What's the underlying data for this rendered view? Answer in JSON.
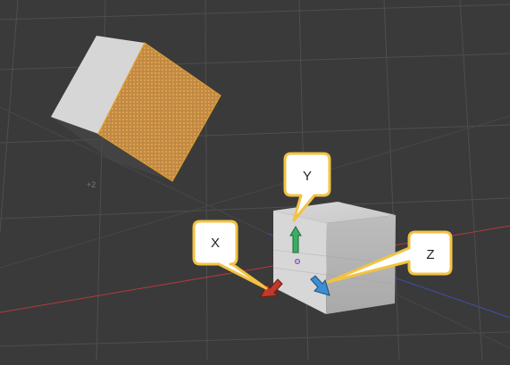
{
  "viewport": {
    "name": "3d-viewport",
    "background": "#3a3a3a",
    "grid_color": "#4f4f4f",
    "x_axis_color": "#b33a3a",
    "z_axis_color": "#3d4fb3",
    "selection_color": "#e0a030"
  },
  "grid_label": "+2",
  "callouts": {
    "x": {
      "label": "X",
      "arrow_color": "#c0392b"
    },
    "y": {
      "label": "Y",
      "arrow_color": "#3cae63"
    },
    "z": {
      "label": "Z",
      "arrow_color": "#3d8fd1"
    }
  },
  "callout_style": {
    "fill": "#ffffff",
    "border": "#f2c242"
  }
}
